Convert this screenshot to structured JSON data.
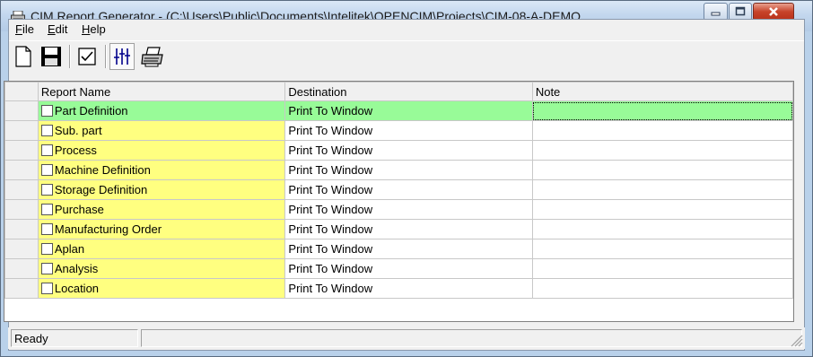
{
  "window": {
    "title": "CIM Report Generator - (C:\\Users\\Public\\Documents\\Intelitek\\OPENCIM\\Projects\\CIM-08-A-DEMO..."
  },
  "menu": [
    {
      "label_ul": "F",
      "label_rest": "ile"
    },
    {
      "label_ul": "E",
      "label_rest": "dit"
    },
    {
      "label_ul": "H",
      "label_rest": "elp"
    }
  ],
  "toolbar": {
    "icons": [
      "new-document-icon",
      "save-icon",
      "check-icon",
      "settings-filter-icon",
      "print-icon"
    ]
  },
  "grid": {
    "columns": [
      "Report Name",
      "Destination",
      "Note"
    ],
    "rows": [
      {
        "name": "Part Definition",
        "destination": "Print To Window",
        "note": "",
        "color": "#98fb98",
        "selected": true
      },
      {
        "name": "Sub. part",
        "destination": "Print To Window",
        "note": "",
        "color": "#ffff80"
      },
      {
        "name": "Process",
        "destination": "Print To Window",
        "note": "",
        "color": "#ffff80"
      },
      {
        "name": "Machine Definition",
        "destination": "Print To Window",
        "note": "",
        "color": "#ffff80"
      },
      {
        "name": "Storage Definition",
        "destination": "Print To Window",
        "note": "",
        "color": "#ffff80"
      },
      {
        "name": "Purchase",
        "destination": "Print To Window",
        "note": "",
        "color": "#ffff80"
      },
      {
        "name": "Manufacturing Order",
        "destination": "Print To Window",
        "note": "",
        "color": "#ffff80"
      },
      {
        "name": "Aplan",
        "destination": "Print To Window",
        "note": "",
        "color": "#ffff80"
      },
      {
        "name": "Analysis",
        "destination": "Print To Window",
        "note": "",
        "color": "#ffff80"
      },
      {
        "name": "Location",
        "destination": "Print To Window",
        "note": "",
        "color": "#ffff80"
      }
    ]
  },
  "status": {
    "text": "Ready"
  }
}
